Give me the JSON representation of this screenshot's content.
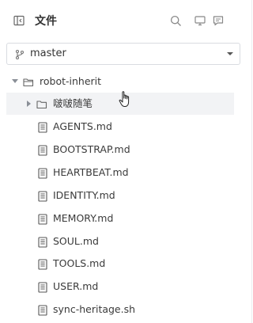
{
  "header": {
    "title": "文件",
    "icons": [
      "sidebar-toggle-icon",
      "search-icon",
      "monitor-icon",
      "message-icon"
    ]
  },
  "branch": {
    "label": "master",
    "icon": "git-branch-icon"
  },
  "tree": {
    "root": {
      "label": "robot-inherit",
      "expanded": true
    },
    "folder": {
      "label": "啵啵随笔",
      "expanded": false
    },
    "files": [
      "AGENTS.md",
      "BOOTSTRAP.md",
      "HEARTBEAT.md",
      "IDENTITY.md",
      "MEMORY.md",
      "SOUL.md",
      "TOOLS.md",
      "USER.md",
      "sync-heritage.sh"
    ]
  },
  "colors": {
    "icon_gray": "#8a8f97",
    "hover_bg": "#f2f3f5",
    "border": "#d9dce1"
  }
}
